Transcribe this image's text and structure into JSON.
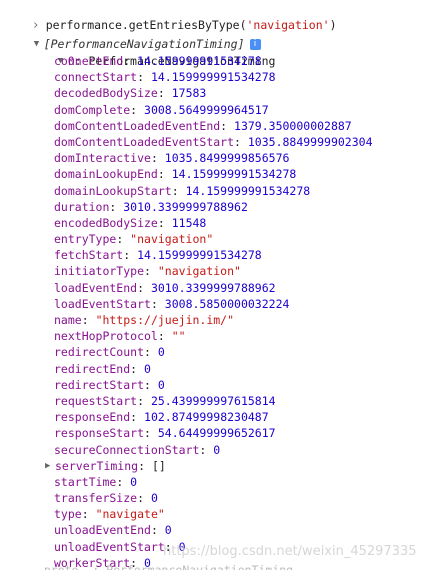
{
  "console": {
    "command_prefix": "performance.getEntriesByType(",
    "command_arg": "'navigation'",
    "command_suffix": ")",
    "array_label": "[PerformanceNavigationTiming]",
    "info_badge": "i",
    "object_index": "0",
    "object_type": "PerformanceNavigationTiming"
  },
  "properties": [
    {
      "key": "connectEnd",
      "value": "14.159999991534278",
      "kind": "number"
    },
    {
      "key": "connectStart",
      "value": "14.159999991534278",
      "kind": "number"
    },
    {
      "key": "decodedBodySize",
      "value": "17583",
      "kind": "number"
    },
    {
      "key": "domComplete",
      "value": "3008.5649999964517",
      "kind": "number"
    },
    {
      "key": "domContentLoadedEventEnd",
      "value": "1379.350000002887",
      "kind": "number"
    },
    {
      "key": "domContentLoadedEventStart",
      "value": "1035.8849999902304",
      "kind": "number"
    },
    {
      "key": "domInteractive",
      "value": "1035.8499999856576",
      "kind": "number"
    },
    {
      "key": "domainLookupEnd",
      "value": "14.159999991534278",
      "kind": "number"
    },
    {
      "key": "domainLookupStart",
      "value": "14.159999991534278",
      "kind": "number"
    },
    {
      "key": "duration",
      "value": "3010.3399999788962",
      "kind": "number"
    },
    {
      "key": "encodedBodySize",
      "value": "11548",
      "kind": "number"
    },
    {
      "key": "entryType",
      "value": "\"navigation\"",
      "kind": "string"
    },
    {
      "key": "fetchStart",
      "value": "14.159999991534278",
      "kind": "number"
    },
    {
      "key": "initiatorType",
      "value": "\"navigation\"",
      "kind": "string"
    },
    {
      "key": "loadEventEnd",
      "value": "3010.3399999788962",
      "kind": "number"
    },
    {
      "key": "loadEventStart",
      "value": "3008.5850000032224",
      "kind": "number"
    },
    {
      "key": "name",
      "value": "\"https://juejin.im/\"",
      "kind": "string"
    },
    {
      "key": "nextHopProtocol",
      "value": "\"\"",
      "kind": "string"
    },
    {
      "key": "redirectCount",
      "value": "0",
      "kind": "number"
    },
    {
      "key": "redirectEnd",
      "value": "0",
      "kind": "number"
    },
    {
      "key": "redirectStart",
      "value": "0",
      "kind": "number"
    },
    {
      "key": "requestStart",
      "value": "25.439999997615814",
      "kind": "number"
    },
    {
      "key": "responseEnd",
      "value": "102.87499998230487",
      "kind": "number"
    },
    {
      "key": "responseStart",
      "value": "54.64499999652617",
      "kind": "number"
    },
    {
      "key": "secureConnectionStart",
      "value": "0",
      "kind": "number"
    },
    {
      "key": "serverTiming",
      "value": "[]",
      "kind": "plain",
      "expandable": true
    },
    {
      "key": "startTime",
      "value": "0",
      "kind": "number"
    },
    {
      "key": "transferSize",
      "value": "0",
      "kind": "number"
    },
    {
      "key": "type",
      "value": "\"navigate\"",
      "kind": "string"
    },
    {
      "key": "unloadEventEnd",
      "value": "0",
      "kind": "number"
    },
    {
      "key": "unloadEventStart",
      "value": "0",
      "kind": "number"
    },
    {
      "key": "workerStart",
      "value": "0",
      "kind": "number"
    }
  ],
  "watermark": "https://blog.csdn.net/weixin_45297335",
  "cutoff_line": "__proto__: PerformanceNavigationTiming"
}
